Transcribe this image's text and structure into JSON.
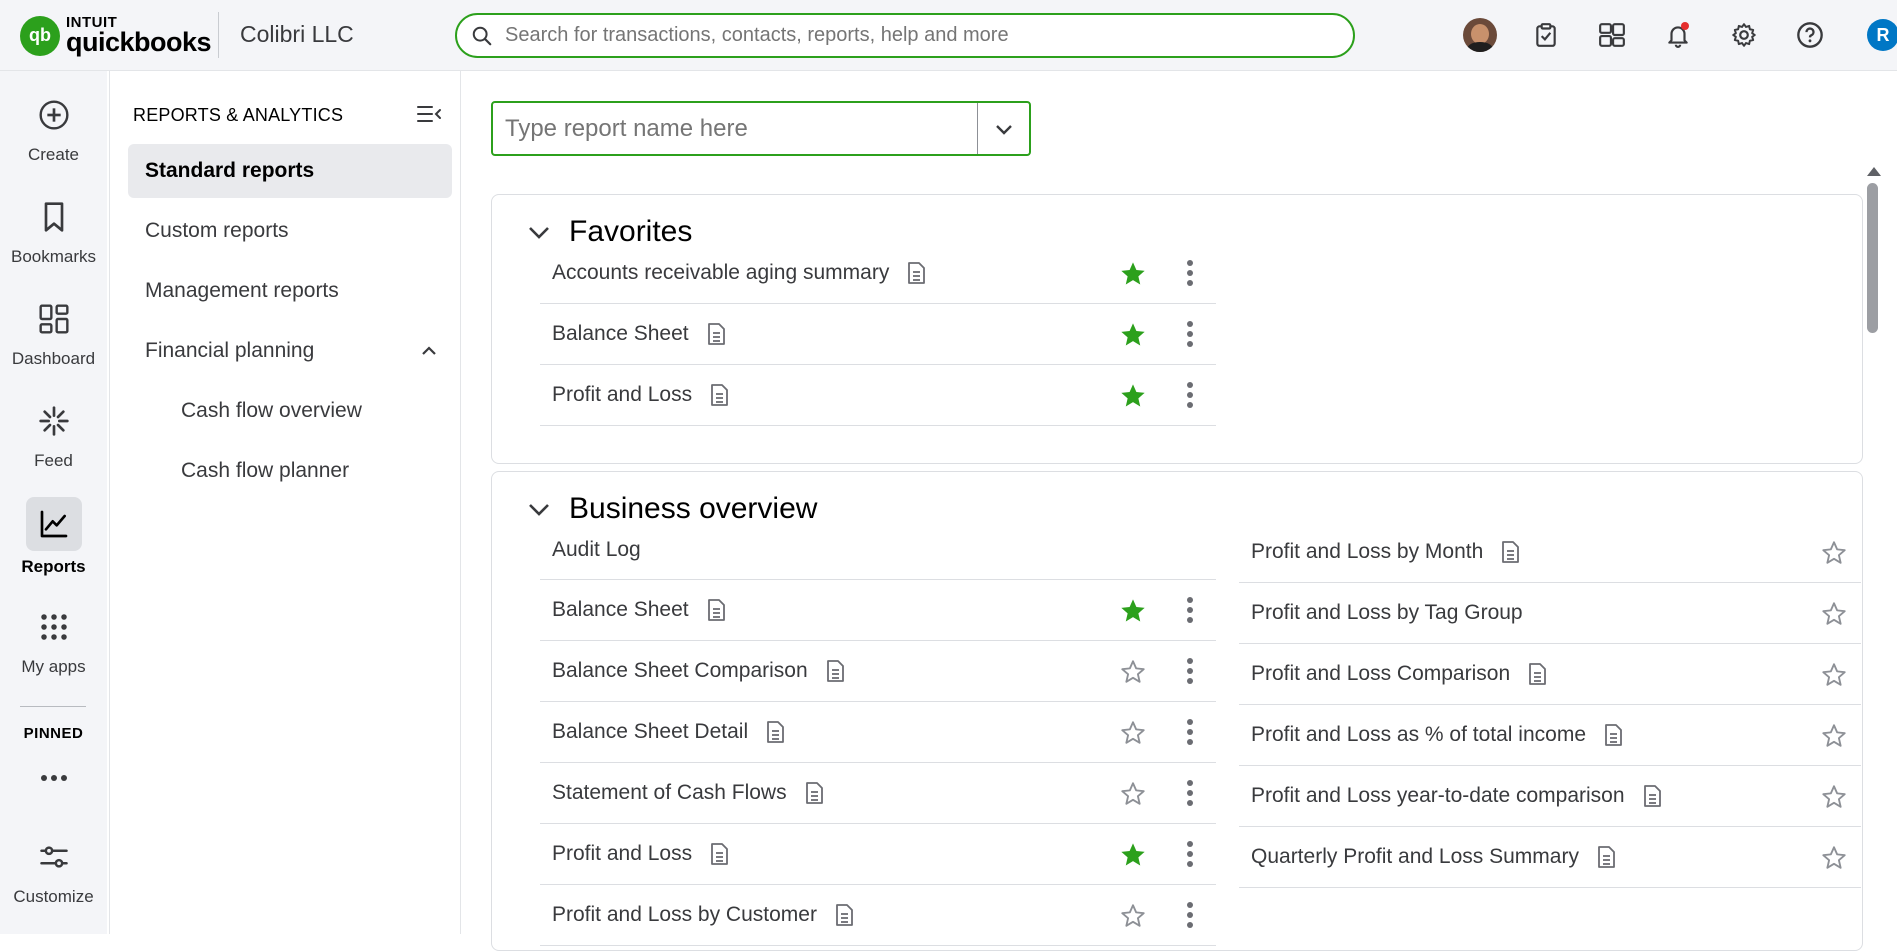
{
  "topbar": {
    "brand_intuit": "INTUIT",
    "brand_quickbooks": "quickbooks",
    "company": "Colibri LLC",
    "search_placeholder": "Search for transactions, contacts, reports, help and more",
    "user_initial": "R",
    "icons": [
      "avatar",
      "task-icon",
      "apps-switch-icon",
      "bell-icon",
      "gear-icon",
      "help-icon"
    ]
  },
  "leftnav": {
    "items": [
      {
        "label": "Create",
        "icon": "plus-circle-icon"
      },
      {
        "label": "Bookmarks",
        "icon": "bookmark-icon"
      },
      {
        "label": "Dashboard",
        "icon": "dashboard-icon"
      },
      {
        "label": "Feed",
        "icon": "feed-icon"
      },
      {
        "label": "Reports",
        "icon": "chart-icon"
      },
      {
        "label": "My apps",
        "icon": "grid-icon"
      },
      {
        "label": "Customize",
        "icon": "sliders-icon"
      }
    ],
    "pinned_label": "PINNED",
    "more_label": "..."
  },
  "sidepanel": {
    "title": "REPORTS & ANALYTICS",
    "items": [
      {
        "label": "Standard reports"
      },
      {
        "label": "Custom reports"
      },
      {
        "label": "Management reports"
      },
      {
        "label": "Financial planning"
      },
      {
        "label": "Cash flow overview"
      },
      {
        "label": "Cash flow planner"
      }
    ]
  },
  "main": {
    "report_search_placeholder": "Type report name here",
    "favorites": {
      "title": "Favorites",
      "reports": [
        {
          "name": "Accounts receivable aging summary",
          "starred": true
        },
        {
          "name": "Balance Sheet",
          "starred": true
        },
        {
          "name": "Profit and Loss",
          "starred": true
        }
      ]
    },
    "business_overview": {
      "title": "Business overview",
      "left": [
        {
          "name": "Audit Log",
          "doc": false,
          "starred": null
        },
        {
          "name": "Balance Sheet",
          "doc": true,
          "starred": true
        },
        {
          "name": "Balance Sheet Comparison",
          "doc": true,
          "starred": false
        },
        {
          "name": "Balance Sheet Detail",
          "doc": true,
          "starred": false
        },
        {
          "name": "Statement of Cash Flows",
          "doc": true,
          "starred": false
        },
        {
          "name": "Profit and Loss",
          "doc": true,
          "starred": true
        },
        {
          "name": "Profit and Loss by Customer",
          "doc": true,
          "starred": false
        }
      ],
      "right": [
        {
          "name": "Profit and Loss by Month",
          "starred": false
        },
        {
          "name": "Profit and Loss by Tag Group",
          "starred": false
        },
        {
          "name": "Profit and Loss Comparison",
          "starred": false
        },
        {
          "name": "Profit and Loss as % of total income",
          "starred": false
        },
        {
          "name": "Profit and Loss year-to-date comparison",
          "starred": false
        },
        {
          "name": "Quarterly Profit and Loss Summary",
          "starred": false
        }
      ]
    }
  },
  "colors": {
    "brand_green": "#2ca01c",
    "star_green": "#2ca01c",
    "blue_badge": "#0077c5"
  }
}
